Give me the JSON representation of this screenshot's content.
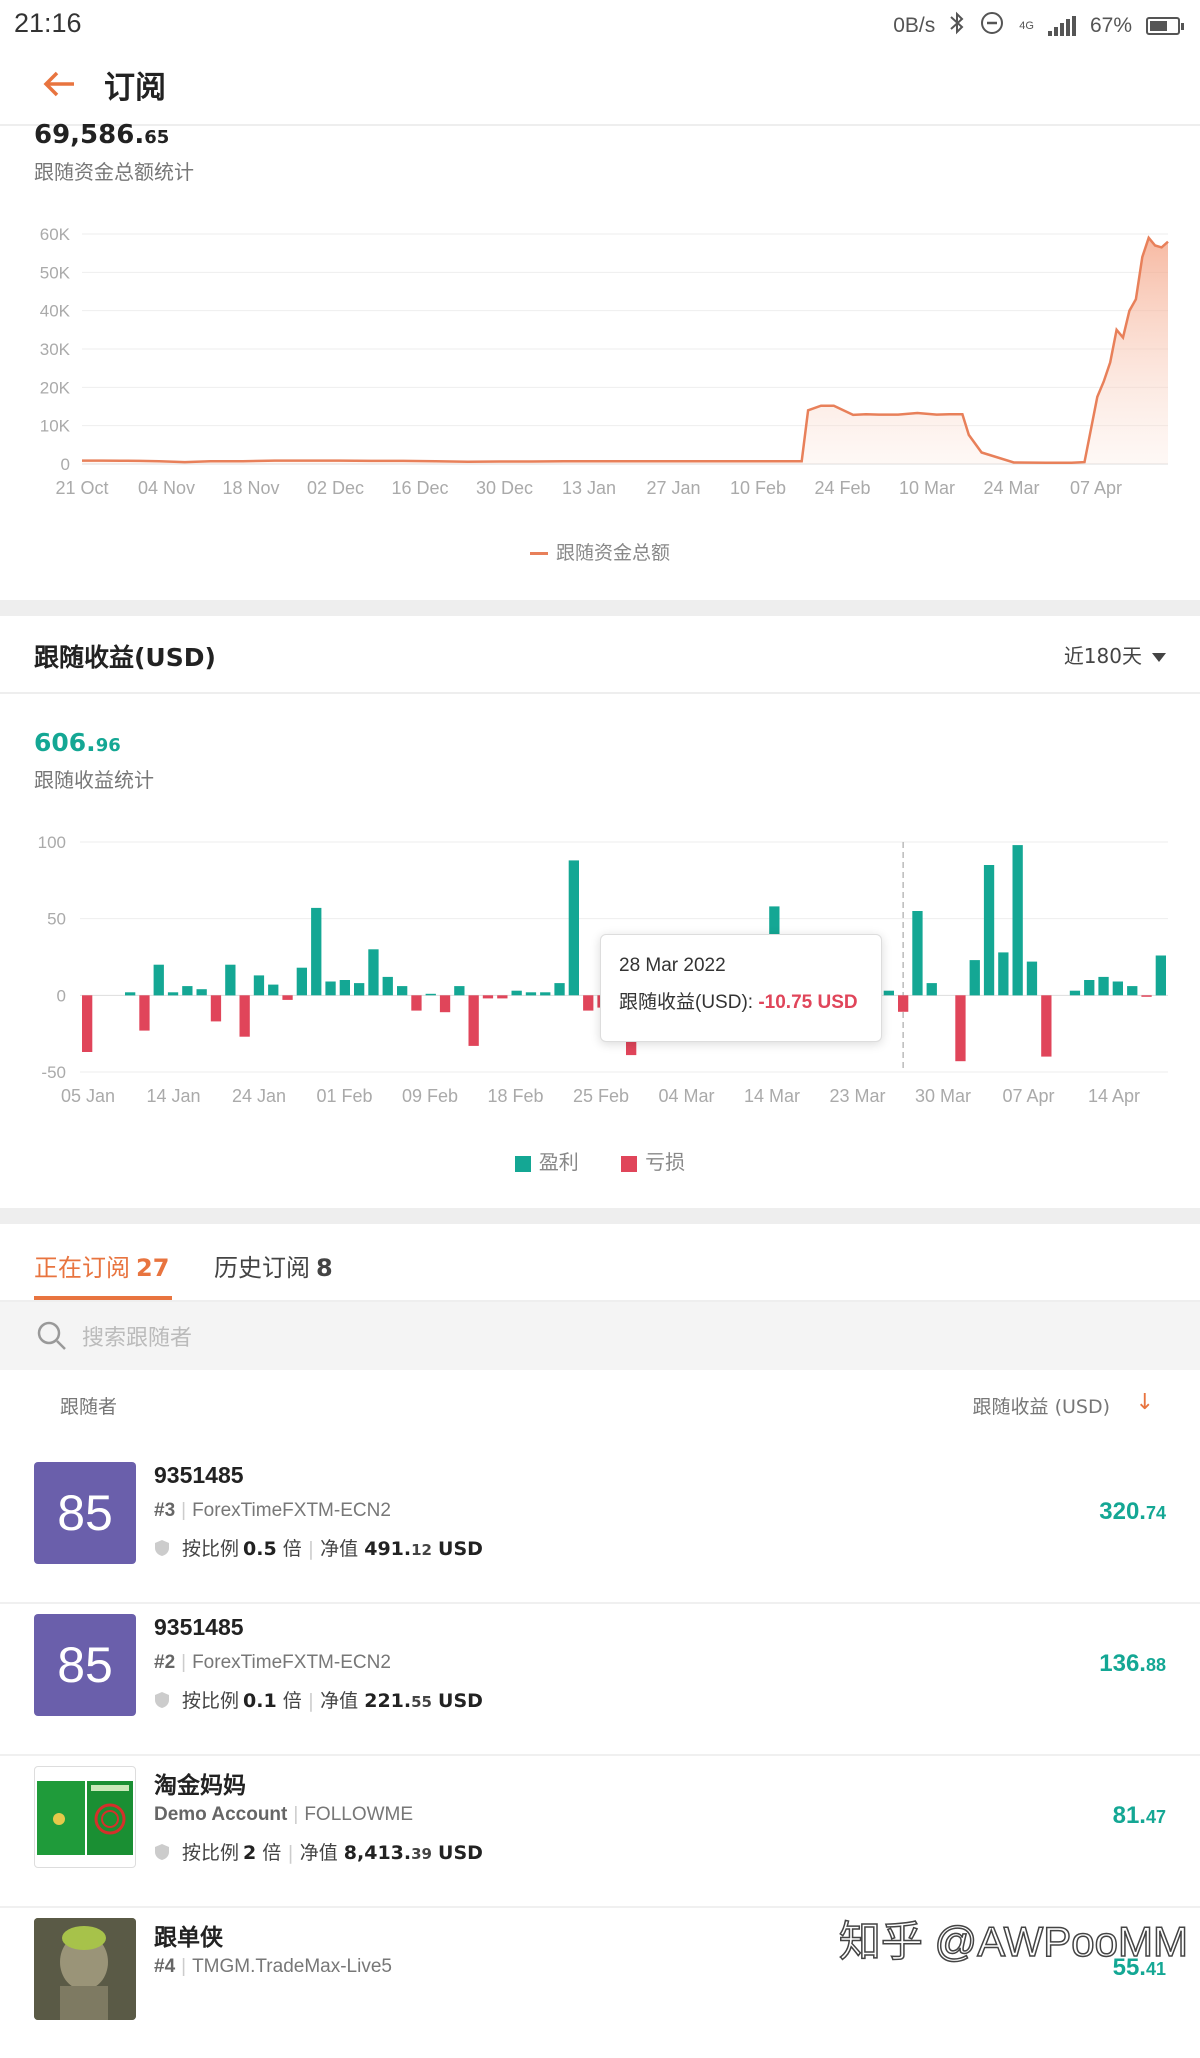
{
  "status_bar": {
    "time": "21:16",
    "net_speed": "0B/s",
    "network": "4G",
    "battery": "67%",
    "battery_level": 0.67
  },
  "header": {
    "title": "订阅"
  },
  "follow_total": {
    "value_main": "69,586.",
    "value_dec": "65",
    "label": "跟随资金总额统计",
    "legend": "跟随资金总额"
  },
  "profit_section": {
    "title": "跟随收益(USD)",
    "range": "近180天",
    "value_main": "606.",
    "value_dec": "96",
    "label": "跟随收益统计",
    "legend_profit": "盈利",
    "legend_loss": "亏损",
    "tooltip_date": "28 Mar 2022",
    "tooltip_label": "跟随收益(USD): ",
    "tooltip_value": "-10.75 USD"
  },
  "chart_data": [
    {
      "type": "area",
      "series": [
        {
          "name": "跟随资金总额",
          "color": "#e8805a"
        }
      ],
      "categories": [
        "21 Oct",
        "04 Nov",
        "18 Nov",
        "02 Dec",
        "16 Dec",
        "30 Dec",
        "13 Jan",
        "27 Jan",
        "10 Feb",
        "24 Feb",
        "10 Mar",
        "24 Mar",
        "07 Apr"
      ],
      "y_ticks": [
        "60K",
        "50K",
        "40K",
        "30K",
        "20K",
        "10K",
        "0"
      ],
      "ylim": [
        0,
        60000
      ],
      "x": [
        0,
        3,
        6,
        9,
        12,
        16,
        20,
        25,
        30,
        35,
        40,
        45,
        50,
        55,
        60,
        65,
        70,
        75,
        80,
        85,
        90,
        95,
        100,
        105,
        110,
        112,
        113,
        115,
        117,
        120,
        122,
        124,
        127,
        130,
        133,
        135,
        137,
        138,
        140,
        145,
        150,
        154,
        156,
        158,
        159,
        160,
        161,
        162,
        163,
        164,
        165,
        166,
        167,
        168,
        169
      ],
      "values": [
        900,
        900,
        850,
        800,
        700,
        500,
        700,
        700,
        900,
        900,
        900,
        800,
        800,
        700,
        600,
        650,
        650,
        700,
        700,
        700,
        700,
        700,
        700,
        700,
        700,
        700,
        14000,
        15200,
        15200,
        12800,
        13000,
        12900,
        12900,
        13300,
        12900,
        13000,
        13000,
        7600,
        3000,
        400,
        300,
        300,
        500,
        17500,
        21500,
        26500,
        35000,
        33000,
        40000,
        43000,
        54000,
        59000,
        57000,
        56500,
        58000
      ],
      "grid": true
    },
    {
      "type": "bar",
      "series": [
        {
          "name": "盈利",
          "color": "#14a794"
        },
        {
          "name": "亏损",
          "color": "#e0455a"
        }
      ],
      "categories": [
        "05 Jan",
        "14 Jan",
        "24 Jan",
        "01 Feb",
        "09 Feb",
        "18 Feb",
        "25 Feb",
        "04 Mar",
        "14 Mar",
        "23 Mar",
        "30 Mar",
        "07 Apr",
        "14 Apr"
      ],
      "y_ticks": [
        "100",
        "50",
        "0",
        "-50"
      ],
      "ylim": [
        -50,
        100
      ],
      "values": [
        -37,
        0,
        0,
        2,
        -23,
        20,
        2,
        6,
        4,
        -17,
        20,
        -27,
        13,
        7,
        -3,
        18,
        57,
        9,
        10,
        8,
        30,
        12,
        6,
        -10,
        1,
        -11,
        6,
        -33,
        -2,
        -2,
        3,
        2,
        2,
        8,
        88,
        -10,
        -8,
        -2,
        -39,
        -5,
        -2,
        -3,
        5,
        -12,
        12,
        4,
        1,
        -10,
        58,
        -15,
        -10,
        -8,
        5,
        4,
        -6,
        -3,
        3,
        -10.75,
        55,
        8,
        0,
        -43,
        23,
        85,
        28,
        98,
        22,
        -40,
        0,
        3,
        10,
        12,
        9,
        6,
        -1,
        26
      ],
      "highlight_index": 57,
      "highlight_label": "28 Mar 2022",
      "grid": true
    }
  ],
  "tabs": [
    {
      "label": "正在订阅",
      "count": "27"
    },
    {
      "label": "历史订阅",
      "count": "8"
    }
  ],
  "search": {
    "placeholder": "搜索跟随者"
  },
  "columns": {
    "follower": "跟随者",
    "earnings": "跟随收益 (USD)"
  },
  "followers": [
    {
      "avatar_text": "85",
      "name": "9351485",
      "rank": "#3",
      "server": "ForexTimeFXTM-ECN2",
      "ratio_label": "按比例",
      "ratio": "0.5",
      "ratio_unit": "倍",
      "equity_label": "净值",
      "equity_main": "491.",
      "equity_dec": "12",
      "currency": "USD",
      "earn_main": "320.",
      "earn_dec": "74"
    },
    {
      "avatar_text": "85",
      "name": "9351485",
      "rank": "#2",
      "server": "ForexTimeFXTM-ECN2",
      "ratio_label": "按比例",
      "ratio": "0.1",
      "ratio_unit": "倍",
      "equity_label": "净值",
      "equity_main": "221.",
      "equity_dec": "55",
      "currency": "USD",
      "earn_main": "136.",
      "earn_dec": "88"
    },
    {
      "avatar_text": "",
      "name": "淘金妈妈",
      "rank": "Demo Account",
      "server": "FOLLOWME",
      "ratio_label": "按比例",
      "ratio": "2",
      "ratio_unit": "倍",
      "equity_label": "净值",
      "equity_main": "8,413.",
      "equity_dec": "39",
      "currency": "USD",
      "earn_main": "81.",
      "earn_dec": "47"
    },
    {
      "avatar_text": "",
      "name": "跟单侠",
      "rank": "#4",
      "server": "TMGM.TradeMax-Live5",
      "ratio_label": "",
      "ratio": "",
      "ratio_unit": "",
      "equity_label": "",
      "equity_main": "",
      "equity_dec": "",
      "currency": "",
      "earn_main": "55.",
      "earn_dec": "41"
    }
  ],
  "watermark": "知乎 @AWPooMM"
}
